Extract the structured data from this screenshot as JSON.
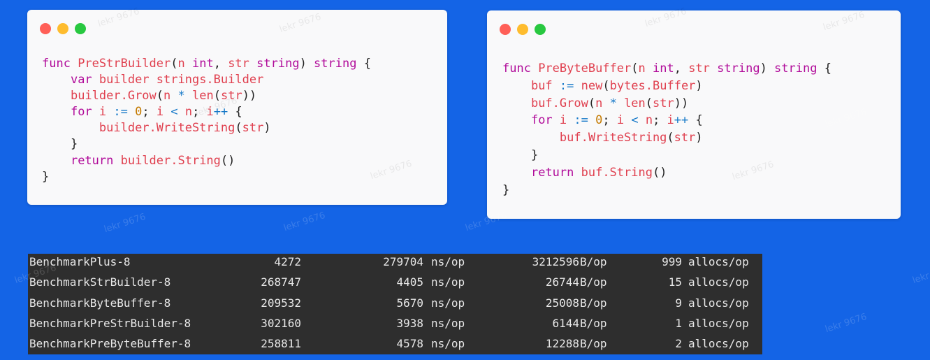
{
  "left_snippet": {
    "lines": [
      [
        {
          "t": "func ",
          "c": "kw"
        },
        {
          "t": "PreStrBuilder",
          "c": "fn"
        },
        {
          "t": "(",
          "c": "pn"
        },
        {
          "t": "n ",
          "c": "id"
        },
        {
          "t": "int",
          "c": "kw"
        },
        {
          "t": ", ",
          "c": "pn"
        },
        {
          "t": "str ",
          "c": "id"
        },
        {
          "t": "string",
          "c": "kw"
        },
        {
          "t": ") ",
          "c": "pn"
        },
        {
          "t": "string",
          "c": "kw"
        },
        {
          "t": " {",
          "c": "pn"
        }
      ],
      [
        {
          "t": "    ",
          "c": "pn"
        },
        {
          "t": "var ",
          "c": "kw"
        },
        {
          "t": "builder strings.Builder",
          "c": "id"
        }
      ],
      [
        {
          "t": "    ",
          "c": "pn"
        },
        {
          "t": "builder.Grow",
          "c": "id"
        },
        {
          "t": "(",
          "c": "pn"
        },
        {
          "t": "n ",
          "c": "id"
        },
        {
          "t": "* ",
          "c": "op"
        },
        {
          "t": "len",
          "c": "fn"
        },
        {
          "t": "(",
          "c": "pn"
        },
        {
          "t": "str",
          "c": "id"
        },
        {
          "t": "))",
          "c": "pn"
        }
      ],
      [
        {
          "t": "    ",
          "c": "pn"
        },
        {
          "t": "for ",
          "c": "kw"
        },
        {
          "t": "i ",
          "c": "id"
        },
        {
          "t": ":= ",
          "c": "op"
        },
        {
          "t": "0",
          "c": "num"
        },
        {
          "t": "; ",
          "c": "pn"
        },
        {
          "t": "i ",
          "c": "id"
        },
        {
          "t": "< ",
          "c": "op"
        },
        {
          "t": "n",
          "c": "id"
        },
        {
          "t": "; ",
          "c": "pn"
        },
        {
          "t": "i",
          "c": "id"
        },
        {
          "t": "++ ",
          "c": "op"
        },
        {
          "t": "{",
          "c": "pn"
        }
      ],
      [
        {
          "t": "        ",
          "c": "pn"
        },
        {
          "t": "builder.WriteString",
          "c": "id"
        },
        {
          "t": "(",
          "c": "pn"
        },
        {
          "t": "str",
          "c": "id"
        },
        {
          "t": ")",
          "c": "pn"
        }
      ],
      [
        {
          "t": "    }",
          "c": "pn"
        }
      ],
      [
        {
          "t": "    ",
          "c": "pn"
        },
        {
          "t": "return ",
          "c": "kw"
        },
        {
          "t": "builder.String",
          "c": "id"
        },
        {
          "t": "()",
          "c": "pn"
        }
      ],
      [
        {
          "t": "}",
          "c": "pn"
        }
      ]
    ]
  },
  "right_snippet": {
    "lines": [
      [
        {
          "t": "func ",
          "c": "kw"
        },
        {
          "t": "PreByteBuffer",
          "c": "fn"
        },
        {
          "t": "(",
          "c": "pn"
        },
        {
          "t": "n ",
          "c": "id"
        },
        {
          "t": "int",
          "c": "kw"
        },
        {
          "t": ", ",
          "c": "pn"
        },
        {
          "t": "str ",
          "c": "id"
        },
        {
          "t": "string",
          "c": "kw"
        },
        {
          "t": ") ",
          "c": "pn"
        },
        {
          "t": "string",
          "c": "kw"
        },
        {
          "t": " {",
          "c": "pn"
        }
      ],
      [
        {
          "t": "    ",
          "c": "pn"
        },
        {
          "t": "buf ",
          "c": "id"
        },
        {
          "t": ":= ",
          "c": "op"
        },
        {
          "t": "new",
          "c": "fn"
        },
        {
          "t": "(",
          "c": "pn"
        },
        {
          "t": "bytes.Buffer",
          "c": "id"
        },
        {
          "t": ")",
          "c": "pn"
        }
      ],
      [
        {
          "t": "    ",
          "c": "pn"
        },
        {
          "t": "buf.Grow",
          "c": "id"
        },
        {
          "t": "(",
          "c": "pn"
        },
        {
          "t": "n ",
          "c": "id"
        },
        {
          "t": "* ",
          "c": "op"
        },
        {
          "t": "len",
          "c": "fn"
        },
        {
          "t": "(",
          "c": "pn"
        },
        {
          "t": "str",
          "c": "id"
        },
        {
          "t": "))",
          "c": "pn"
        }
      ],
      [
        {
          "t": "    ",
          "c": "pn"
        },
        {
          "t": "for ",
          "c": "kw"
        },
        {
          "t": "i ",
          "c": "id"
        },
        {
          "t": ":= ",
          "c": "op"
        },
        {
          "t": "0",
          "c": "num"
        },
        {
          "t": "; ",
          "c": "pn"
        },
        {
          "t": "i ",
          "c": "id"
        },
        {
          "t": "< ",
          "c": "op"
        },
        {
          "t": "n",
          "c": "id"
        },
        {
          "t": "; ",
          "c": "pn"
        },
        {
          "t": "i",
          "c": "id"
        },
        {
          "t": "++ ",
          "c": "op"
        },
        {
          "t": "{",
          "c": "pn"
        }
      ],
      [
        {
          "t": "        ",
          "c": "pn"
        },
        {
          "t": "buf.WriteString",
          "c": "id"
        },
        {
          "t": "(",
          "c": "pn"
        },
        {
          "t": "str",
          "c": "id"
        },
        {
          "t": ")",
          "c": "pn"
        }
      ],
      [
        {
          "t": "    }",
          "c": "pn"
        }
      ],
      [
        {
          "t": "    ",
          "c": "pn"
        },
        {
          "t": "return ",
          "c": "kw"
        },
        {
          "t": "buf.String",
          "c": "id"
        },
        {
          "t": "()",
          "c": "pn"
        }
      ],
      [
        {
          "t": "}",
          "c": "pn"
        }
      ]
    ]
  },
  "benchmarks": [
    {
      "name": "BenchmarkPlus-8",
      "iterations": "4272",
      "ns": "279704",
      "ns_unit": "ns/op",
      "bytes": "3212596",
      "bytes_unit": "B/op",
      "allocs": "999",
      "allocs_unit": "allocs/op"
    },
    {
      "name": "BenchmarkStrBuilder-8",
      "iterations": "268747",
      "ns": "4405",
      "ns_unit": "ns/op",
      "bytes": "26744",
      "bytes_unit": "B/op",
      "allocs": "15",
      "allocs_unit": "allocs/op"
    },
    {
      "name": "BenchmarkByteBuffer-8",
      "iterations": "209532",
      "ns": "5670",
      "ns_unit": "ns/op",
      "bytes": "25008",
      "bytes_unit": "B/op",
      "allocs": "9",
      "allocs_unit": "allocs/op"
    },
    {
      "name": "BenchmarkPreStrBuilder-8",
      "iterations": "302160",
      "ns": "3938",
      "ns_unit": "ns/op",
      "bytes": "6144",
      "bytes_unit": "B/op",
      "allocs": "1",
      "allocs_unit": "allocs/op"
    },
    {
      "name": "BenchmarkPreByteBuffer-8",
      "iterations": "258811",
      "ns": "4578",
      "ns_unit": "ns/op",
      "bytes": "12288",
      "bytes_unit": "B/op",
      "allocs": "2",
      "allocs_unit": "allocs/op"
    }
  ],
  "watermark": "lekr 9676",
  "colors": {
    "background": "#1464e6",
    "keyword": "#b10c9a",
    "identifier": "#e0404f",
    "operator": "#1578c8",
    "number": "#c47a00",
    "terminal": "#2e2e2e"
  }
}
